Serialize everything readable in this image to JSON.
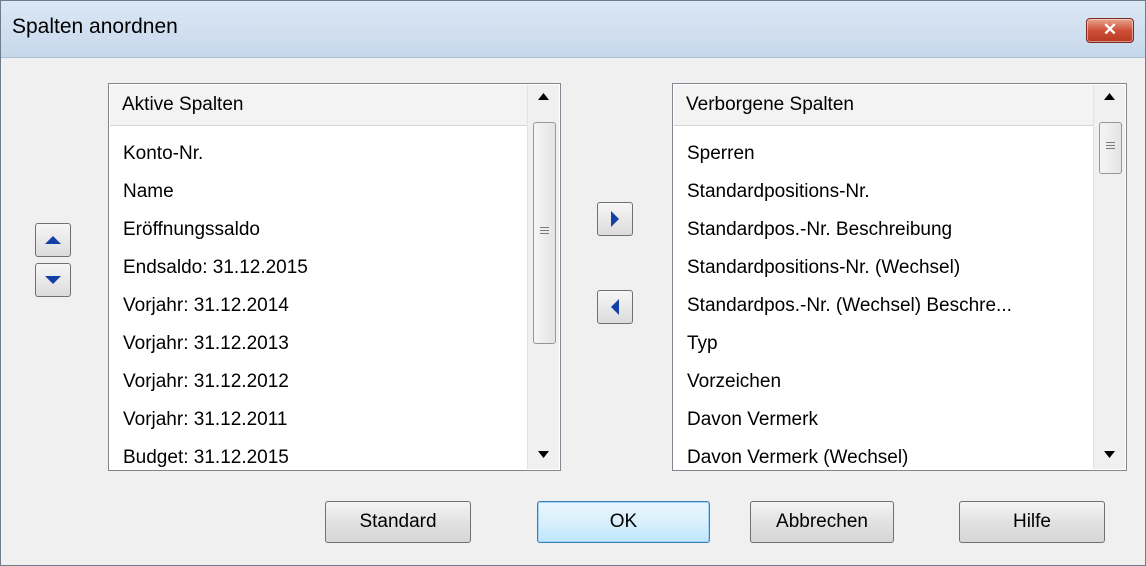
{
  "window": {
    "title": "Spalten anordnen",
    "close_label": "✕"
  },
  "active_columns": {
    "header": "Aktive Spalten",
    "items": [
      "Konto-Nr.",
      "Name",
      "Eröffnungssaldo",
      "Endsaldo: 31.12.2015",
      "Vorjahr: 31.12.2014",
      "Vorjahr: 31.12.2013",
      "Vorjahr: 31.12.2012",
      "Vorjahr: 31.12.2011",
      "Budget: 31.12.2015"
    ]
  },
  "hidden_columns": {
    "header": "Verborgene Spalten",
    "items": [
      "Sperren",
      "Standardpositions-Nr.",
      "Standardpos.-Nr. Beschreibung",
      "Standardpositions-Nr. (Wechsel)",
      "Standardpos.-Nr. (Wechsel) Beschre...",
      "Typ",
      "Vorzeichen",
      "Davon Vermerk",
      "Davon Vermerk (Wechsel)"
    ]
  },
  "buttons": {
    "standard": "Standard",
    "ok": "OK",
    "cancel": "Abbrechen",
    "help": "Hilfe"
  },
  "icons": {
    "move_up": "triangle-up-icon",
    "move_down": "triangle-down-icon",
    "add_to_hidden": "triangle-right-icon",
    "add_to_active": "triangle-left-icon"
  },
  "colors": {
    "arrow_blue": "#1340a8",
    "title_bar": "#c7d8ec",
    "close_red": "#cf4f36"
  }
}
